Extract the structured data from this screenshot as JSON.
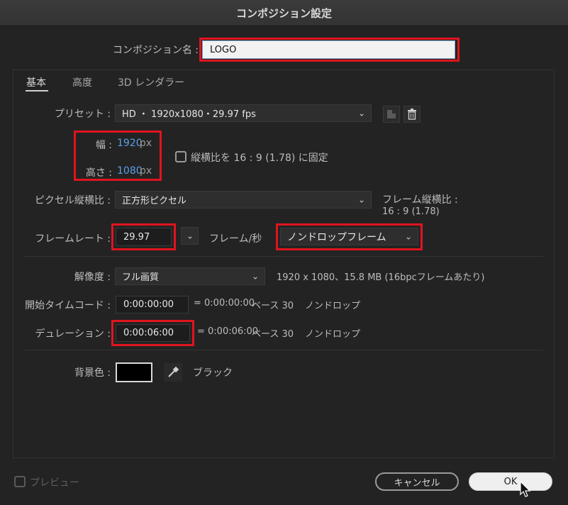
{
  "window": {
    "title": "コンポジション設定"
  },
  "composition_name": {
    "label": "コンポジション名 :",
    "value": "LOGO"
  },
  "tabs": [
    {
      "label": "基本"
    },
    {
      "label": "高度"
    },
    {
      "label": "3D レンダラー"
    }
  ],
  "preset": {
    "label": "プリセット :",
    "value": "HD ・ 1920x1080・29.97 fps"
  },
  "width": {
    "label": "幅 :",
    "value": "1920",
    "unit": "px"
  },
  "height": {
    "label": "高さ :",
    "value": "1080",
    "unit": "px"
  },
  "lock_aspect": {
    "label": "縦横比を 16 : 9 (1.78) に固定",
    "checked": false
  },
  "pixel_aspect": {
    "label": "ピクセル縦横比 :",
    "value": "正方形ピクセル"
  },
  "frame_aspect": {
    "label": "フレーム縦横比 :",
    "value": "16 : 9 (1.78)"
  },
  "frame_rate": {
    "label": "フレームレート :",
    "value": "29.97",
    "unit": "フレーム/秒",
    "drop": "ノンドロップフレーム"
  },
  "resolution": {
    "label": "解像度 :",
    "value": "フル画質",
    "info": "1920 x 1080、15.8 MB (16bpcフレームあたり)"
  },
  "start_timecode": {
    "label": "開始タイムコード :",
    "value": "0:00:00:00",
    "equals": "= 0:00:00:00",
    "base": "ベース 30",
    "drop": "ノンドロップ"
  },
  "duration": {
    "label": "デュレーション :",
    "value": "0:00:06:00",
    "equals": "= 0:00:06:00",
    "base": "ベース 30",
    "drop": "ノンドロップ"
  },
  "background": {
    "label": "背景色 :",
    "color": "#000000",
    "name": "ブラック"
  },
  "preview": {
    "label": "プレビュー"
  },
  "buttons": {
    "cancel": "キャンセル",
    "ok": "OK"
  },
  "colors": {
    "highlight": "#e0141e",
    "link": "#5aa0e8"
  }
}
